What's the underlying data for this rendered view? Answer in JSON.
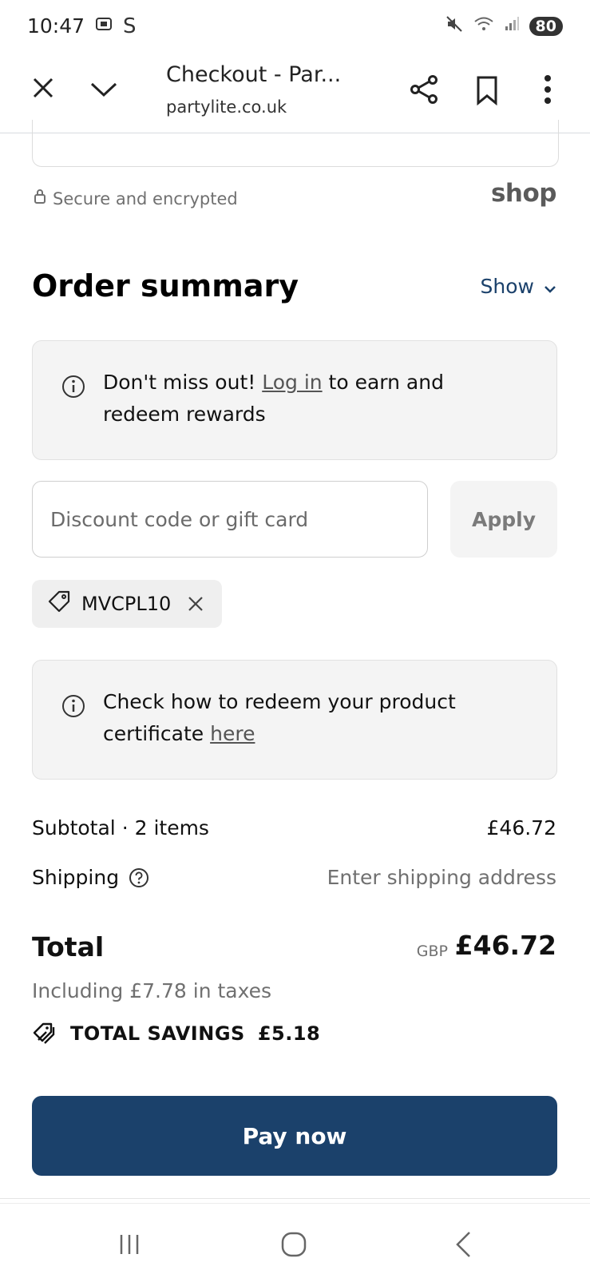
{
  "status_bar": {
    "time": "10:47",
    "left_glyphs": [
      "screenshot-icon",
      "S"
    ],
    "s_label": "S",
    "battery": "80"
  },
  "browser": {
    "title": "Checkout - Par...",
    "url": "partylite.co.uk"
  },
  "page": {
    "secure_text": "Secure and encrypted",
    "shop_logo": "shop",
    "order_summary_title": "Order summary",
    "show_label": "Show",
    "rewards_banner": {
      "prefix": "Don't miss out! ",
      "link": "Log in",
      "suffix": " to earn and redeem rewards"
    },
    "discount": {
      "placeholder": "Discount code or gift card",
      "apply_label": "Apply",
      "applied_code": "MVCPL10"
    },
    "certificate_banner": {
      "prefix": "Check how to redeem your product certificate ",
      "link": "here"
    },
    "subtotal_label": "Subtotal · 2 items",
    "subtotal_value": "£46.72",
    "shipping_label": "Shipping",
    "shipping_value": "Enter shipping address",
    "total_label": "Total",
    "currency": "GBP",
    "total_value": "£46.72",
    "tax_text": "Including £7.78 in taxes",
    "savings_label": "TOTAL SAVINGS",
    "savings_value": "£5.18",
    "pay_label": "Pay now"
  },
  "colors": {
    "accent": "#1b416b",
    "banner_bg": "#f4f4f4",
    "muted_text": "#707070"
  }
}
